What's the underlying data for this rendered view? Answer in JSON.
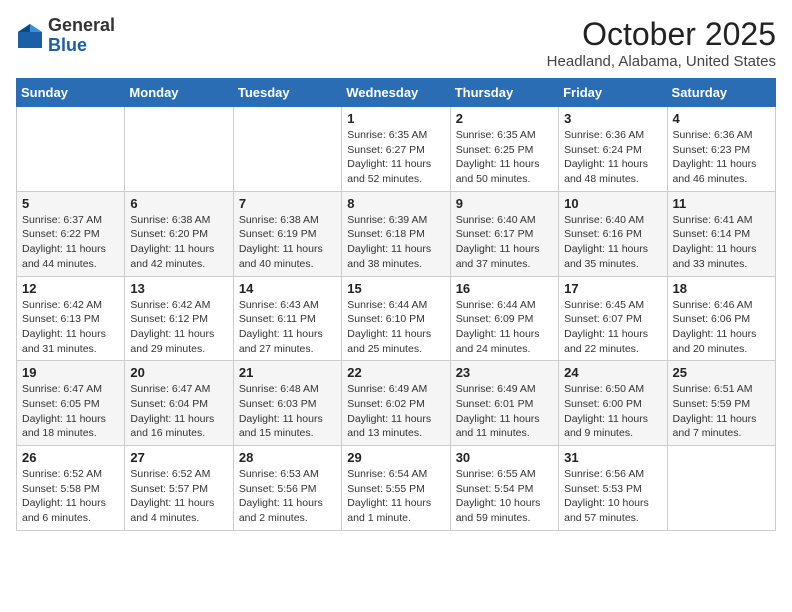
{
  "header": {
    "logo": {
      "line1": "General",
      "line2": "Blue"
    },
    "title": "October 2025",
    "location": "Headland, Alabama, United States"
  },
  "weekdays": [
    "Sunday",
    "Monday",
    "Tuesday",
    "Wednesday",
    "Thursday",
    "Friday",
    "Saturday"
  ],
  "weeks": [
    [
      {
        "day": "",
        "info": ""
      },
      {
        "day": "",
        "info": ""
      },
      {
        "day": "",
        "info": ""
      },
      {
        "day": "1",
        "info": "Sunrise: 6:35 AM\nSunset: 6:27 PM\nDaylight: 11 hours and 52 minutes."
      },
      {
        "day": "2",
        "info": "Sunrise: 6:35 AM\nSunset: 6:25 PM\nDaylight: 11 hours and 50 minutes."
      },
      {
        "day": "3",
        "info": "Sunrise: 6:36 AM\nSunset: 6:24 PM\nDaylight: 11 hours and 48 minutes."
      },
      {
        "day": "4",
        "info": "Sunrise: 6:36 AM\nSunset: 6:23 PM\nDaylight: 11 hours and 46 minutes."
      }
    ],
    [
      {
        "day": "5",
        "info": "Sunrise: 6:37 AM\nSunset: 6:22 PM\nDaylight: 11 hours and 44 minutes."
      },
      {
        "day": "6",
        "info": "Sunrise: 6:38 AM\nSunset: 6:20 PM\nDaylight: 11 hours and 42 minutes."
      },
      {
        "day": "7",
        "info": "Sunrise: 6:38 AM\nSunset: 6:19 PM\nDaylight: 11 hours and 40 minutes."
      },
      {
        "day": "8",
        "info": "Sunrise: 6:39 AM\nSunset: 6:18 PM\nDaylight: 11 hours and 38 minutes."
      },
      {
        "day": "9",
        "info": "Sunrise: 6:40 AM\nSunset: 6:17 PM\nDaylight: 11 hours and 37 minutes."
      },
      {
        "day": "10",
        "info": "Sunrise: 6:40 AM\nSunset: 6:16 PM\nDaylight: 11 hours and 35 minutes."
      },
      {
        "day": "11",
        "info": "Sunrise: 6:41 AM\nSunset: 6:14 PM\nDaylight: 11 hours and 33 minutes."
      }
    ],
    [
      {
        "day": "12",
        "info": "Sunrise: 6:42 AM\nSunset: 6:13 PM\nDaylight: 11 hours and 31 minutes."
      },
      {
        "day": "13",
        "info": "Sunrise: 6:42 AM\nSunset: 6:12 PM\nDaylight: 11 hours and 29 minutes."
      },
      {
        "day": "14",
        "info": "Sunrise: 6:43 AM\nSunset: 6:11 PM\nDaylight: 11 hours and 27 minutes."
      },
      {
        "day": "15",
        "info": "Sunrise: 6:44 AM\nSunset: 6:10 PM\nDaylight: 11 hours and 25 minutes."
      },
      {
        "day": "16",
        "info": "Sunrise: 6:44 AM\nSunset: 6:09 PM\nDaylight: 11 hours and 24 minutes."
      },
      {
        "day": "17",
        "info": "Sunrise: 6:45 AM\nSunset: 6:07 PM\nDaylight: 11 hours and 22 minutes."
      },
      {
        "day": "18",
        "info": "Sunrise: 6:46 AM\nSunset: 6:06 PM\nDaylight: 11 hours and 20 minutes."
      }
    ],
    [
      {
        "day": "19",
        "info": "Sunrise: 6:47 AM\nSunset: 6:05 PM\nDaylight: 11 hours and 18 minutes."
      },
      {
        "day": "20",
        "info": "Sunrise: 6:47 AM\nSunset: 6:04 PM\nDaylight: 11 hours and 16 minutes."
      },
      {
        "day": "21",
        "info": "Sunrise: 6:48 AM\nSunset: 6:03 PM\nDaylight: 11 hours and 15 minutes."
      },
      {
        "day": "22",
        "info": "Sunrise: 6:49 AM\nSunset: 6:02 PM\nDaylight: 11 hours and 13 minutes."
      },
      {
        "day": "23",
        "info": "Sunrise: 6:49 AM\nSunset: 6:01 PM\nDaylight: 11 hours and 11 minutes."
      },
      {
        "day": "24",
        "info": "Sunrise: 6:50 AM\nSunset: 6:00 PM\nDaylight: 11 hours and 9 minutes."
      },
      {
        "day": "25",
        "info": "Sunrise: 6:51 AM\nSunset: 5:59 PM\nDaylight: 11 hours and 7 minutes."
      }
    ],
    [
      {
        "day": "26",
        "info": "Sunrise: 6:52 AM\nSunset: 5:58 PM\nDaylight: 11 hours and 6 minutes."
      },
      {
        "day": "27",
        "info": "Sunrise: 6:52 AM\nSunset: 5:57 PM\nDaylight: 11 hours and 4 minutes."
      },
      {
        "day": "28",
        "info": "Sunrise: 6:53 AM\nSunset: 5:56 PM\nDaylight: 11 hours and 2 minutes."
      },
      {
        "day": "29",
        "info": "Sunrise: 6:54 AM\nSunset: 5:55 PM\nDaylight: 11 hours and 1 minute."
      },
      {
        "day": "30",
        "info": "Sunrise: 6:55 AM\nSunset: 5:54 PM\nDaylight: 10 hours and 59 minutes."
      },
      {
        "day": "31",
        "info": "Sunrise: 6:56 AM\nSunset: 5:53 PM\nDaylight: 10 hours and 57 minutes."
      },
      {
        "day": "",
        "info": ""
      }
    ]
  ]
}
